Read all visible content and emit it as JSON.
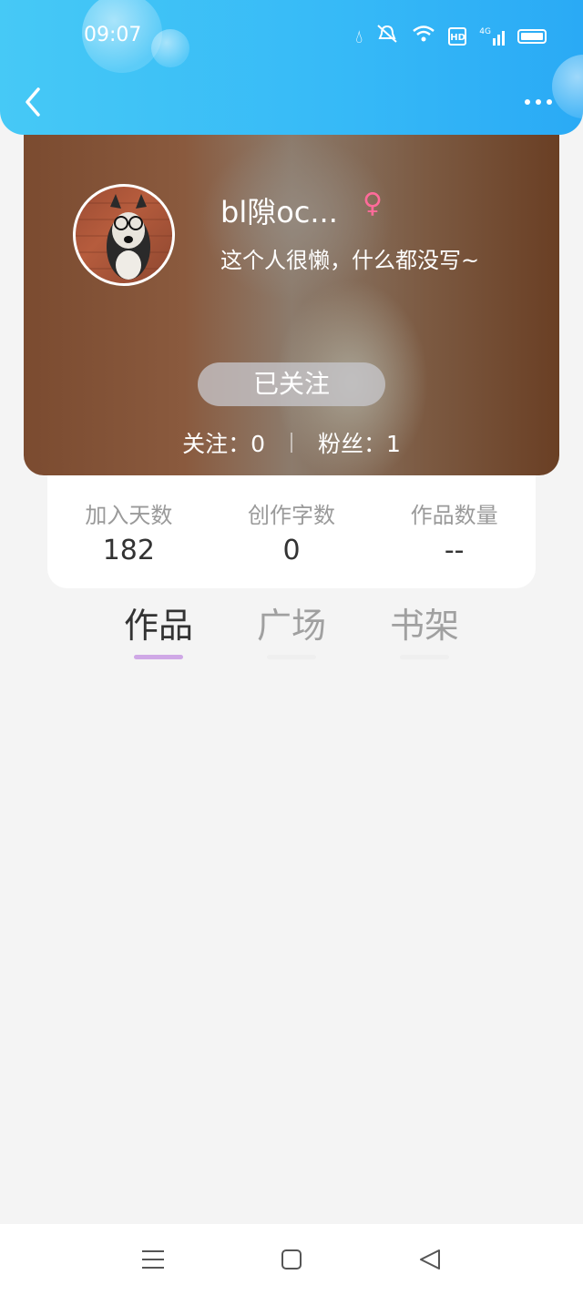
{
  "status": {
    "time": "09:07",
    "hd_label": "HD",
    "network_label": "4G"
  },
  "header": {
    "back_icon": "chevron-left-icon",
    "more_icon": "more-dots-icon"
  },
  "profile": {
    "username": "bl隙oc...",
    "gender_symbol": "♀",
    "bio": "这个人很懒，什么都没写~",
    "follow_button_label": "已关注",
    "following_text": "关注：0",
    "fans_text": "粉丝：1"
  },
  "stats": [
    {
      "label": "加入天数",
      "value": "182"
    },
    {
      "label": "创作字数",
      "value": "0"
    },
    {
      "label": "作品数量",
      "value": "--"
    }
  ],
  "tabs": [
    {
      "label": "作品",
      "active": true
    },
    {
      "label": "广场",
      "active": false
    },
    {
      "label": "书架",
      "active": false
    }
  ],
  "colors": {
    "header": "#36b9f7",
    "tab_indicator": "#cfa8e6",
    "gender": "#ff6b9a"
  }
}
